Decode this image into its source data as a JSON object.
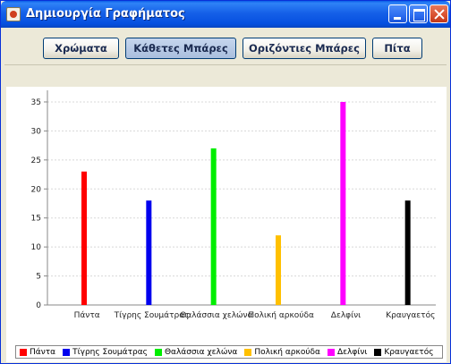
{
  "window": {
    "title": "Δημιουργία Γραφήματος"
  },
  "toolbar": {
    "colors_label": "Χρώματα",
    "vbars_label": "Κάθετες Μπάρες",
    "hbars_label": "Οριζόντιες Μπάρες",
    "pie_label": "Πίτα"
  },
  "chart_data": {
    "type": "bar",
    "title": "",
    "xlabel": "",
    "ylabel": "",
    "ylim": [
      0,
      37
    ],
    "yticks": [
      "0",
      "5",
      "10",
      "15",
      "20",
      "25",
      "30",
      "35"
    ],
    "grid": true,
    "legend_placement": "bottom",
    "categories": [
      "Πάντα",
      "Τίγρης Σουμάτρας",
      "Θαλάσσια χελώνα",
      "Πολική αρκούδα",
      "Δελφίνι",
      "Κραυγαετός"
    ],
    "values": [
      23,
      18,
      27,
      12,
      35,
      18
    ],
    "colors": [
      "#ff0000",
      "#0000ee",
      "#00ee00",
      "#ffc000",
      "#ff00ff",
      "#000000"
    ]
  }
}
